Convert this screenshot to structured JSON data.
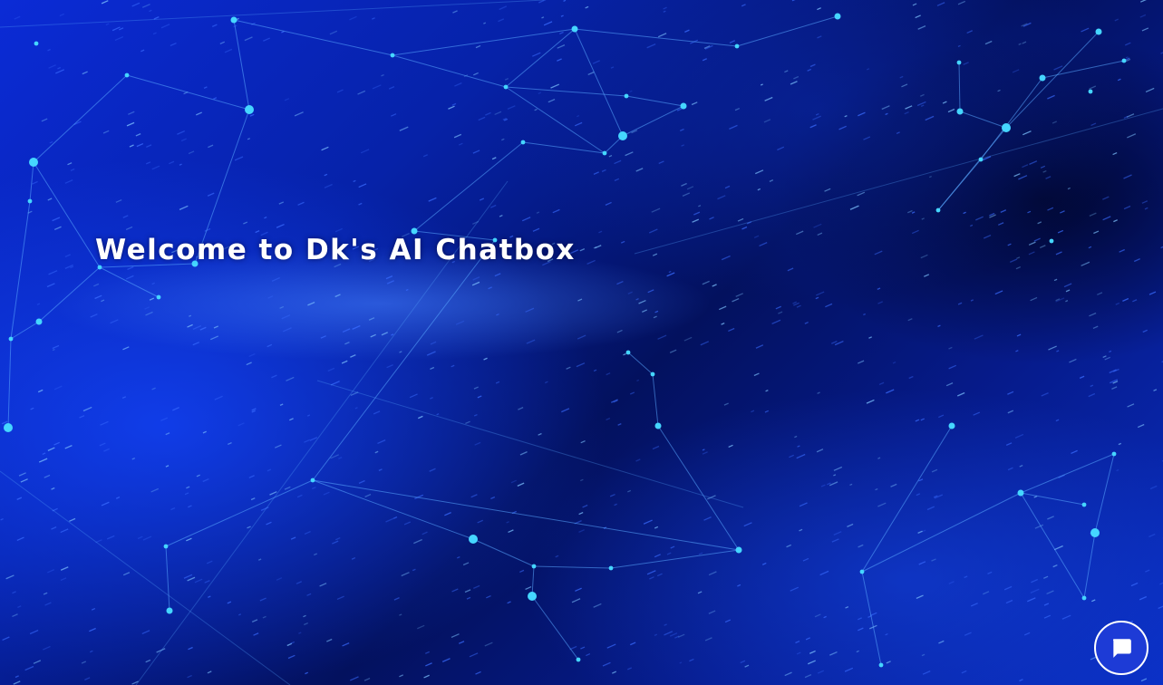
{
  "hero": {
    "title": "Welcome to Dk's AI Chatbox"
  },
  "chat_launcher": {
    "icon": "chat-bubble-icon"
  },
  "colors": {
    "background_primary": "#0622a8",
    "background_dark": "#03115e",
    "accent_glow": "#3fd0ff",
    "title_text": "#ffffff",
    "launcher_bg": "#1d3bd6"
  }
}
